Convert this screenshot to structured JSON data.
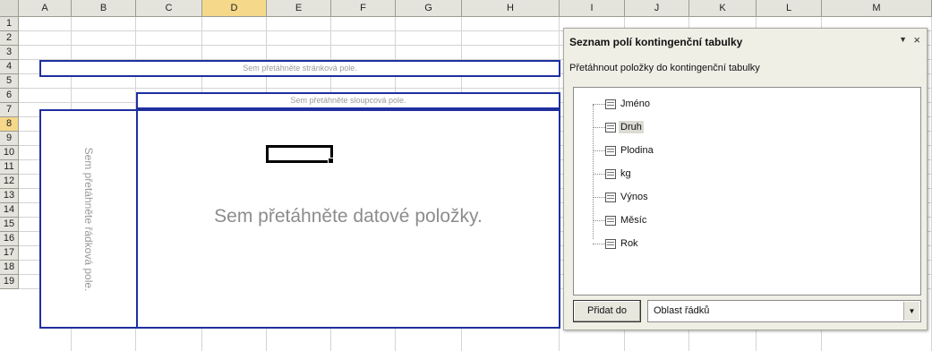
{
  "sheet": {
    "columns": [
      "A",
      "B",
      "C",
      "D",
      "E",
      "F",
      "G",
      "H",
      "I",
      "J",
      "K",
      "L",
      "M"
    ],
    "rows": [
      "1",
      "2",
      "3",
      "4",
      "5",
      "6",
      "7",
      "8",
      "9",
      "10",
      "11",
      "12",
      "13",
      "14",
      "15",
      "16",
      "17",
      "18",
      "19"
    ],
    "active_column": "D",
    "active_row": "8"
  },
  "drop_zones": {
    "page": "Sem přetáhněte stránková pole.",
    "column": "Sem přetáhněte sloupcová pole.",
    "row": "Sem přetáhněte řádková pole.",
    "data": "Sem přetáhněte datové položky."
  },
  "pane": {
    "title": "Seznam polí kontingenční tabulky",
    "menu_icon": "▼",
    "close_icon": "×",
    "subtitle": "Přetáhnout položky do kontingenční tabulky",
    "fields": [
      {
        "label": "Jméno",
        "selected": false
      },
      {
        "label": "Druh",
        "selected": true
      },
      {
        "label": "Plodina",
        "selected": false
      },
      {
        "label": "kg",
        "selected": false
      },
      {
        "label": "Výnos",
        "selected": false
      },
      {
        "label": "Měsíc",
        "selected": false
      },
      {
        "label": "Rok",
        "selected": false
      }
    ],
    "add_button": "Přidat do",
    "area_value": "Oblast řádků",
    "area_arrow": "▼"
  }
}
